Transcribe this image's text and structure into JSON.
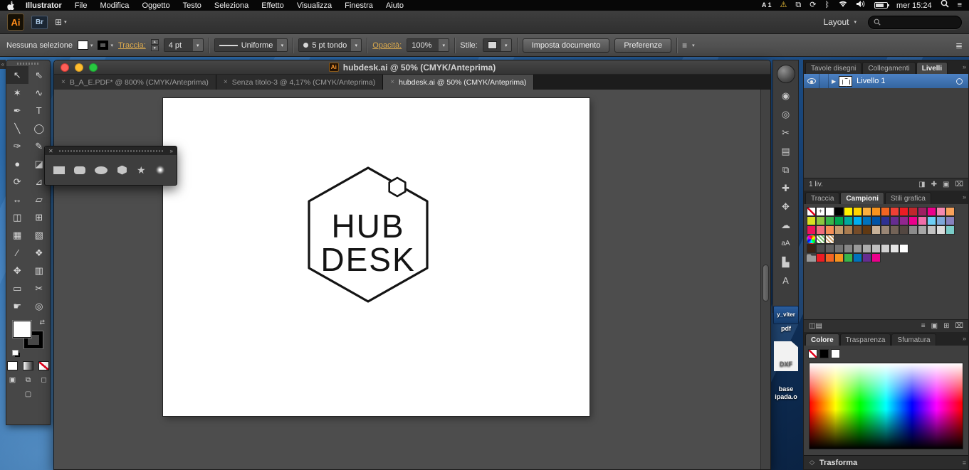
{
  "menubar": {
    "app_name": "Illustrator",
    "menus": [
      "File",
      "Modifica",
      "Oggetto",
      "Testo",
      "Seleziona",
      "Effetto",
      "Visualizza",
      "Finestra",
      "Aiuto"
    ],
    "input_source": "A 1",
    "clock": "mer 15:24"
  },
  "appbar": {
    "logo": "Ai",
    "bridge": "Br",
    "layout_label": "Layout"
  },
  "controlbar": {
    "selection_label": "Nessuna selezione",
    "stroke_label": "Traccia:",
    "stroke_value": "4 pt",
    "profile_value": "Uniforme",
    "brush_value": "5 pt tondo",
    "opacity_label": "Opacità:",
    "opacity_value": "100%",
    "style_label": "Stile:",
    "doc_setup_button": "Imposta documento",
    "preferences_button": "Preferenze"
  },
  "window": {
    "title": "hubdesk.ai @ 50% (CMYK/Anteprima)",
    "tabs": [
      "B_A_E.PDF* @ 800% (CMYK/Anteprima)",
      "Senza titolo-3 @ 4,17% (CMYK/Anteprima)",
      "hubdesk.ai @ 50% (CMYK/Anteprima)"
    ],
    "active_tab": 2
  },
  "artboard": {
    "logo_line1": "HUB",
    "logo_line2": "DESK"
  },
  "toolbox": [
    {
      "name": "selection",
      "glyph": "↖"
    },
    {
      "name": "direct-selection",
      "glyph": "⇖"
    },
    {
      "name": "magic-wand",
      "glyph": "✶"
    },
    {
      "name": "lasso",
      "glyph": "∿"
    },
    {
      "name": "pen",
      "glyph": "✒"
    },
    {
      "name": "type",
      "glyph": "T"
    },
    {
      "name": "line-segment",
      "glyph": "╲"
    },
    {
      "name": "ellipse",
      "glyph": "◯"
    },
    {
      "name": "paintbrush",
      "glyph": "✑"
    },
    {
      "name": "pencil",
      "glyph": "✎"
    },
    {
      "name": "blob-brush",
      "glyph": "●"
    },
    {
      "name": "eraser",
      "glyph": "◪"
    },
    {
      "name": "rotate",
      "glyph": "⟳"
    },
    {
      "name": "scale",
      "glyph": "⊿"
    },
    {
      "name": "width",
      "glyph": "↔"
    },
    {
      "name": "free-transform",
      "glyph": "▱"
    },
    {
      "name": "shape-builder",
      "glyph": "◫"
    },
    {
      "name": "perspective-grid",
      "glyph": "⊞"
    },
    {
      "name": "mesh",
      "glyph": "▦"
    },
    {
      "name": "gradient",
      "glyph": "▧"
    },
    {
      "name": "eyedropper",
      "glyph": "∕"
    },
    {
      "name": "blend",
      "glyph": "❖"
    },
    {
      "name": "symbol-sprayer",
      "glyph": "✥"
    },
    {
      "name": "column-graph",
      "glyph": "▥"
    },
    {
      "name": "artboard",
      "glyph": "▭"
    },
    {
      "name": "slice",
      "glyph": "✂"
    },
    {
      "name": "hand",
      "glyph": "☛"
    },
    {
      "name": "zoom",
      "glyph": "◎"
    }
  ],
  "shapes_panel": {
    "tools": [
      "rectangle",
      "rounded-rectangle",
      "ellipse",
      "polygon",
      "star",
      "flare"
    ]
  },
  "icon_dock": [
    {
      "name": "color-guide-icon",
      "glyph": "◉"
    },
    {
      "name": "navigator-icon",
      "glyph": "◎"
    },
    {
      "name": "pathfinder-icon",
      "glyph": "✂"
    },
    {
      "name": "appearance-icon",
      "glyph": "▤"
    },
    {
      "name": "artboards-panel-icon",
      "glyph": "⧉"
    },
    {
      "name": "align-icon",
      "glyph": "✚"
    },
    {
      "name": "symbols-icon",
      "glyph": "✥"
    },
    {
      "name": "cloud-icon",
      "glyph": "☁"
    },
    {
      "name": "character-icon",
      "glyph": "aA"
    },
    {
      "name": "graph-icon",
      "glyph": "▙"
    },
    {
      "name": "glyphs-icon",
      "glyph": "A"
    }
  ],
  "desktop_files": {
    "pdf": {
      "line1": "y_viter",
      "line2": "pdf"
    },
    "dxf": "DXF",
    "base": {
      "line1": "base",
      "line2": "ipada.o"
    }
  },
  "panels": {
    "top_tabs": [
      "Tavole disegni",
      "Collegamenti",
      "Livelli"
    ],
    "layer": {
      "name": "Livello 1"
    },
    "layers_status": "1 liv.",
    "swatch_tabs": [
      "Traccia",
      "Campioni",
      "Stili grafica"
    ],
    "swatches": [
      "none",
      "reg",
      "#ffffff",
      "#000000",
      "#fff200",
      "#ffd400",
      "#fbaf3f",
      "#f7941e",
      "#f26522",
      "#ef4036",
      "#ed1c24",
      "#c1272d",
      "#9e1f63",
      "#ec008c",
      "#f588b0",
      "#f9a25b",
      "#d9e021",
      "#8dc63f",
      "#39b54a",
      "#00a651",
      "#00a99d",
      "#00aeef",
      "#0072bc",
      "#0054a6",
      "#2e3192",
      "#662d91",
      "#92278f",
      "#ec008c",
      "#f06eaa",
      "#6dcff6",
      "#7da7d9",
      "#8781bd",
      "#ed145b",
      "#f26d7d",
      "#f68e56",
      "#c49a6c",
      "#a97c50",
      "#754c29",
      "#603913",
      "#c7b299",
      "#998675",
      "#736357",
      "#534741",
      "#8b8b8b",
      "#a7a7a7",
      "#c3c3c3",
      "#dcdcdc",
      "#7accc8",
      "cgroup",
      "pat1",
      "pat2",
      "empty",
      "empty",
      "empty",
      "empty",
      "empty",
      "empty",
      "empty",
      "empty",
      "empty",
      "empty",
      "empty",
      "empty",
      "empty",
      "#3b2314",
      "#4d4d4d",
      "#606060",
      "#737373",
      "#868686",
      "#999999",
      "#acacac",
      "#bfbfbf",
      "#d2d2d2",
      "#e5e5e5",
      "#ffffff",
      "empty",
      "empty",
      "empty",
      "empty",
      "empty",
      "folder",
      "#ed1c24",
      "#f26522",
      "#f7941e",
      "#39b54a",
      "#0072bc",
      "#662d91",
      "#ec008c",
      "empty",
      "empty",
      "empty",
      "empty",
      "empty",
      "empty",
      "empty",
      "empty"
    ],
    "color_tabs": [
      "Colore",
      "Trasparenza",
      "Sfumatura"
    ],
    "transform_label": "Trasforma"
  }
}
